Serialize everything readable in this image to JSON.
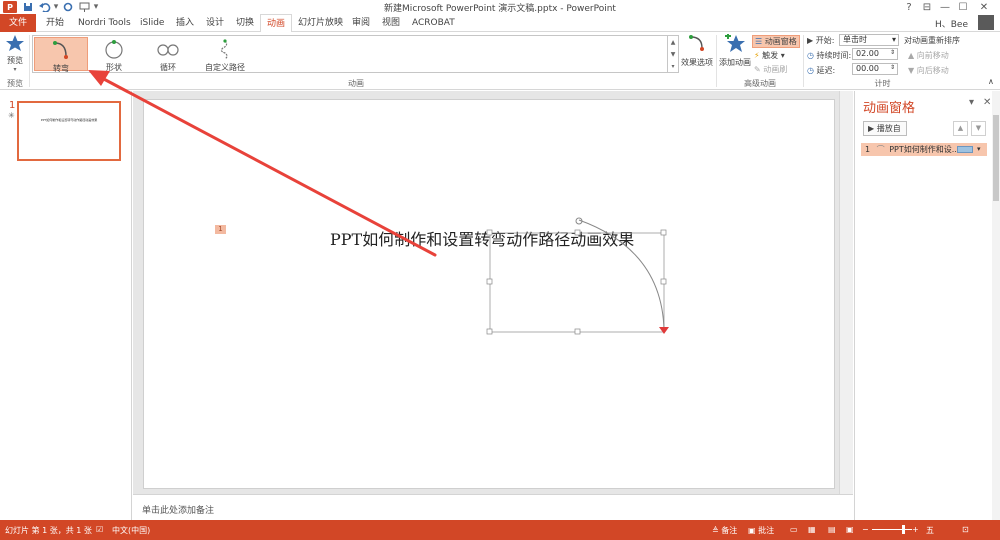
{
  "app": {
    "title": "新建Microsoft PowerPoint 演示文稿.pptx - PowerPoint",
    "logo": "P",
    "user": "H、Bee",
    "help": "?",
    "restore": "⊟",
    "minimize": "—",
    "maximize": "☐",
    "close": "✕"
  },
  "quick_access": {
    "save_icon": "save-icon",
    "undo_icon": "undo-icon",
    "redo_icon": "redo-icon",
    "present_icon": "present-icon"
  },
  "tabs": {
    "file": "文件",
    "home": "开始",
    "nordri": "Nordri Tools",
    "islide": "iSlide",
    "insert": "插入",
    "design": "设计",
    "transitions": "切换",
    "animations": "动画",
    "slideshow": "幻灯片放映",
    "review": "审阅",
    "view": "视图",
    "acrobat": "ACROBAT"
  },
  "ribbon": {
    "preview_label": "预览",
    "preview_group": "预览",
    "animation_group": "动画",
    "advanced_group": "高级动画",
    "timing_group": "计时",
    "gallery": {
      "turn": "转弯",
      "shape": "形状",
      "loop": "循环",
      "custom_path": "自定义路径"
    },
    "effect_options": "效果选项",
    "add_animation": "添加动画",
    "animation_pane": "动画窗格",
    "trigger": "触发 ▾",
    "animation_painter": "动画刷",
    "start_label": "▶ 开始:",
    "start_value": "单击时",
    "duration_label": "持续时间:",
    "duration_value": "02.00",
    "delay_label": "延迟:",
    "delay_value": "00.00",
    "reorder_title": "对动画重新排序",
    "move_earlier": "▲ 向前移动",
    "move_later": "▼ 向后移动"
  },
  "slides_panel": {
    "number": "1",
    "star": "✳",
    "thumb_text": "PPT如何制作和设置转弯动作路径动画效果"
  },
  "slide": {
    "title": "PPT如何制作和设置转弯动作路径动画效果",
    "anim_tag": "1"
  },
  "notes": {
    "placeholder": "单击此处添加备注"
  },
  "anim_pane": {
    "title": "动画窗格",
    "dropdown": "▾",
    "close": "✕",
    "play_from": "▶ 播放自",
    "item_number": "1",
    "item_label": "PPT如何制作和设..."
  },
  "statusbar": {
    "slide_info": "幻灯片 第 1 张，共 1 张",
    "language": "中文(中国)",
    "notes": "≜ 备注",
    "comments": "▣ 批注",
    "zoom_label": "五"
  },
  "colors": {
    "accent": "#d24726",
    "highlight": "#f7c6ad",
    "arrow": "#e8423a"
  }
}
